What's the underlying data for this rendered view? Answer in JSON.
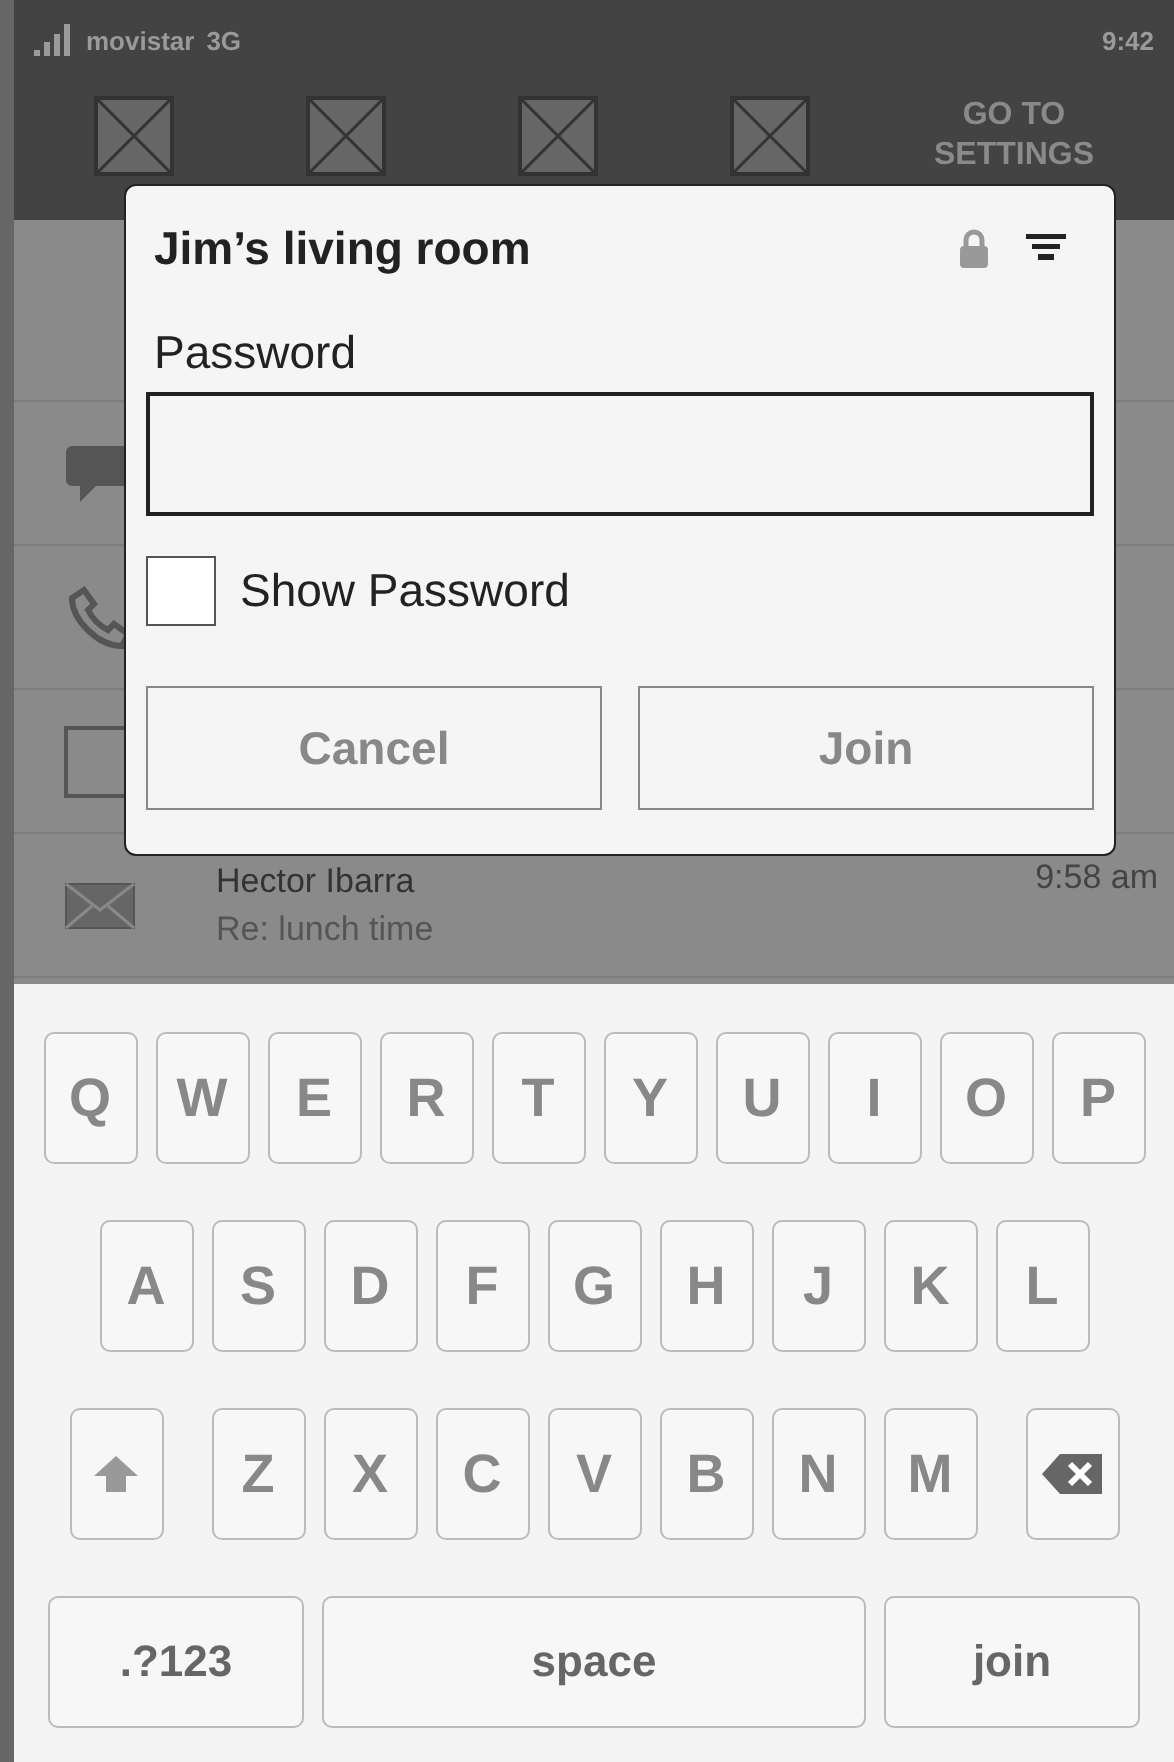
{
  "status_bar": {
    "carrier": "movistar",
    "network": "3G",
    "time": "9:42"
  },
  "quick_settings": {
    "settings_link": "GO TO SETTINGS"
  },
  "notifications": [
    {
      "kind": "chat"
    },
    {
      "kind": "call"
    },
    {
      "kind": "app"
    },
    {
      "kind": "mail",
      "name": "Hector Ibarra",
      "message": "Re: lunch time",
      "time": "9:58 am"
    }
  ],
  "dialog": {
    "title": "Jim’s living room",
    "secured": true,
    "field_label": "Password",
    "show_password": {
      "label": "Show Password",
      "checked": false
    },
    "buttons": [
      {
        "label": "Cancel"
      },
      {
        "label": "Join"
      }
    ]
  },
  "keyboard": {
    "rows": [
      [
        "Q",
        "W",
        "E",
        "R",
        "T",
        "Y",
        "U",
        "I",
        "O",
        "P"
      ],
      [
        "A",
        "S",
        "D",
        "F",
        "G",
        "H",
        "J",
        "K",
        "L"
      ],
      [
        "Z",
        "X",
        "C",
        "V",
        "B",
        "N",
        "M"
      ]
    ],
    "symbols_key": ".?123",
    "space_key": "space",
    "action_key": "join"
  }
}
